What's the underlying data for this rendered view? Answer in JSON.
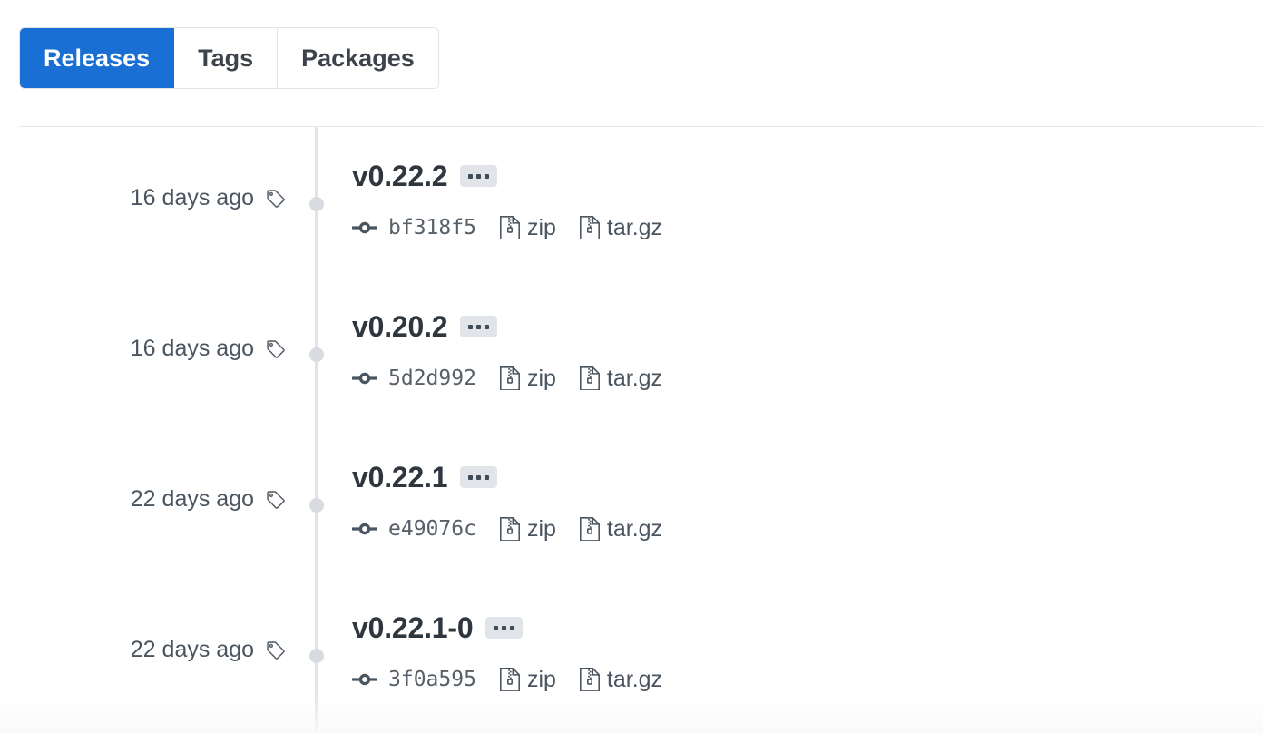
{
  "tabs": [
    {
      "label": "Releases",
      "selected": true
    },
    {
      "label": "Tags",
      "selected": false
    },
    {
      "label": "Packages",
      "selected": false
    }
  ],
  "colors": {
    "accent": "#1a6fd4",
    "border": "#e1e4e8",
    "text": "#24292e",
    "muted": "#4a5560",
    "timeline": "#e1e4e8",
    "dot": "#d8dce1",
    "badge_bg": "#e1e4e8"
  },
  "icons": {
    "tag": "tag-icon",
    "commit": "git-commit-icon",
    "file_zip": "file-zip-icon",
    "kebab": "kebab-horizontal-icon"
  },
  "releases": [
    {
      "date": "16 days ago",
      "version": "v0.22.2",
      "commit": "bf318f5",
      "assets": [
        {
          "label": "zip"
        },
        {
          "label": "tar.gz"
        }
      ]
    },
    {
      "date": "16 days ago",
      "version": "v0.20.2",
      "commit": "5d2d992",
      "assets": [
        {
          "label": "zip"
        },
        {
          "label": "tar.gz"
        }
      ]
    },
    {
      "date": "22 days ago",
      "version": "v0.22.1",
      "commit": "e49076c",
      "assets": [
        {
          "label": "zip"
        },
        {
          "label": "tar.gz"
        }
      ]
    },
    {
      "date": "22 days ago",
      "version": "v0.22.1-0",
      "commit": "3f0a595",
      "assets": [
        {
          "label": "zip"
        },
        {
          "label": "tar.gz"
        }
      ]
    }
  ]
}
